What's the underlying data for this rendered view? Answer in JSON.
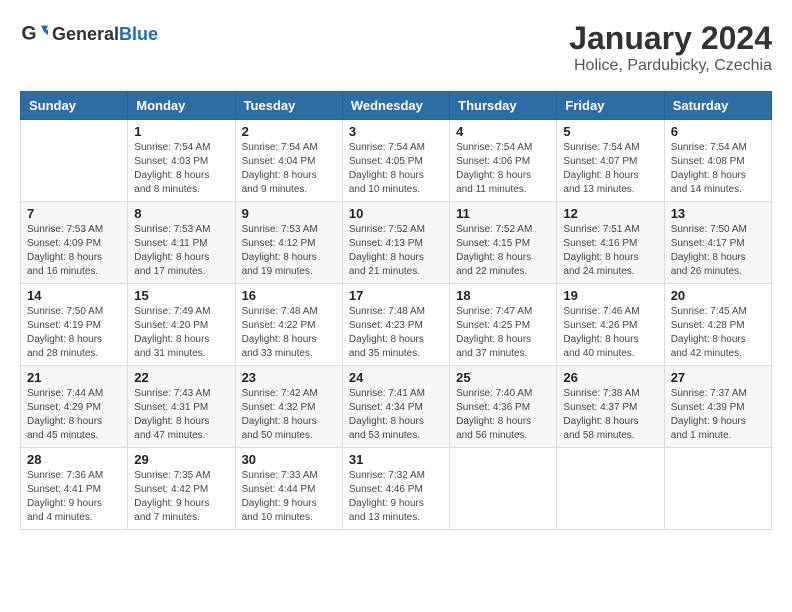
{
  "header": {
    "logo_general": "General",
    "logo_blue": "Blue",
    "title": "January 2024",
    "subtitle": "Holice, Pardubicky, Czechia"
  },
  "columns": [
    "Sunday",
    "Monday",
    "Tuesday",
    "Wednesday",
    "Thursday",
    "Friday",
    "Saturday"
  ],
  "weeks": [
    [
      {
        "day": "",
        "info": ""
      },
      {
        "day": "1",
        "info": "Sunrise: 7:54 AM\nSunset: 4:03 PM\nDaylight: 8 hours\nand 8 minutes."
      },
      {
        "day": "2",
        "info": "Sunrise: 7:54 AM\nSunset: 4:04 PM\nDaylight: 8 hours\nand 9 minutes."
      },
      {
        "day": "3",
        "info": "Sunrise: 7:54 AM\nSunset: 4:05 PM\nDaylight: 8 hours\nand 10 minutes."
      },
      {
        "day": "4",
        "info": "Sunrise: 7:54 AM\nSunset: 4:06 PM\nDaylight: 8 hours\nand 11 minutes."
      },
      {
        "day": "5",
        "info": "Sunrise: 7:54 AM\nSunset: 4:07 PM\nDaylight: 8 hours\nand 13 minutes."
      },
      {
        "day": "6",
        "info": "Sunrise: 7:54 AM\nSunset: 4:08 PM\nDaylight: 8 hours\nand 14 minutes."
      }
    ],
    [
      {
        "day": "7",
        "info": "Sunrise: 7:53 AM\nSunset: 4:09 PM\nDaylight: 8 hours\nand 16 minutes."
      },
      {
        "day": "8",
        "info": "Sunrise: 7:53 AM\nSunset: 4:11 PM\nDaylight: 8 hours\nand 17 minutes."
      },
      {
        "day": "9",
        "info": "Sunrise: 7:53 AM\nSunset: 4:12 PM\nDaylight: 8 hours\nand 19 minutes."
      },
      {
        "day": "10",
        "info": "Sunrise: 7:52 AM\nSunset: 4:13 PM\nDaylight: 8 hours\nand 21 minutes."
      },
      {
        "day": "11",
        "info": "Sunrise: 7:52 AM\nSunset: 4:15 PM\nDaylight: 8 hours\nand 22 minutes."
      },
      {
        "day": "12",
        "info": "Sunrise: 7:51 AM\nSunset: 4:16 PM\nDaylight: 8 hours\nand 24 minutes."
      },
      {
        "day": "13",
        "info": "Sunrise: 7:50 AM\nSunset: 4:17 PM\nDaylight: 8 hours\nand 26 minutes."
      }
    ],
    [
      {
        "day": "14",
        "info": "Sunrise: 7:50 AM\nSunset: 4:19 PM\nDaylight: 8 hours\nand 28 minutes."
      },
      {
        "day": "15",
        "info": "Sunrise: 7:49 AM\nSunset: 4:20 PM\nDaylight: 8 hours\nand 31 minutes."
      },
      {
        "day": "16",
        "info": "Sunrise: 7:48 AM\nSunset: 4:22 PM\nDaylight: 8 hours\nand 33 minutes."
      },
      {
        "day": "17",
        "info": "Sunrise: 7:48 AM\nSunset: 4:23 PM\nDaylight: 8 hours\nand 35 minutes."
      },
      {
        "day": "18",
        "info": "Sunrise: 7:47 AM\nSunset: 4:25 PM\nDaylight: 8 hours\nand 37 minutes."
      },
      {
        "day": "19",
        "info": "Sunrise: 7:46 AM\nSunset: 4:26 PM\nDaylight: 8 hours\nand 40 minutes."
      },
      {
        "day": "20",
        "info": "Sunrise: 7:45 AM\nSunset: 4:28 PM\nDaylight: 8 hours\nand 42 minutes."
      }
    ],
    [
      {
        "day": "21",
        "info": "Sunrise: 7:44 AM\nSunset: 4:29 PM\nDaylight: 8 hours\nand 45 minutes."
      },
      {
        "day": "22",
        "info": "Sunrise: 7:43 AM\nSunset: 4:31 PM\nDaylight: 8 hours\nand 47 minutes."
      },
      {
        "day": "23",
        "info": "Sunrise: 7:42 AM\nSunset: 4:32 PM\nDaylight: 8 hours\nand 50 minutes."
      },
      {
        "day": "24",
        "info": "Sunrise: 7:41 AM\nSunset: 4:34 PM\nDaylight: 8 hours\nand 53 minutes."
      },
      {
        "day": "25",
        "info": "Sunrise: 7:40 AM\nSunset: 4:36 PM\nDaylight: 8 hours\nand 56 minutes."
      },
      {
        "day": "26",
        "info": "Sunrise: 7:38 AM\nSunset: 4:37 PM\nDaylight: 8 hours\nand 58 minutes."
      },
      {
        "day": "27",
        "info": "Sunrise: 7:37 AM\nSunset: 4:39 PM\nDaylight: 9 hours\nand 1 minute."
      }
    ],
    [
      {
        "day": "28",
        "info": "Sunrise: 7:36 AM\nSunset: 4:41 PM\nDaylight: 9 hours\nand 4 minutes."
      },
      {
        "day": "29",
        "info": "Sunrise: 7:35 AM\nSunset: 4:42 PM\nDaylight: 9 hours\nand 7 minutes."
      },
      {
        "day": "30",
        "info": "Sunrise: 7:33 AM\nSunset: 4:44 PM\nDaylight: 9 hours\nand 10 minutes."
      },
      {
        "day": "31",
        "info": "Sunrise: 7:32 AM\nSunset: 4:46 PM\nDaylight: 9 hours\nand 13 minutes."
      },
      {
        "day": "",
        "info": ""
      },
      {
        "day": "",
        "info": ""
      },
      {
        "day": "",
        "info": ""
      }
    ]
  ]
}
